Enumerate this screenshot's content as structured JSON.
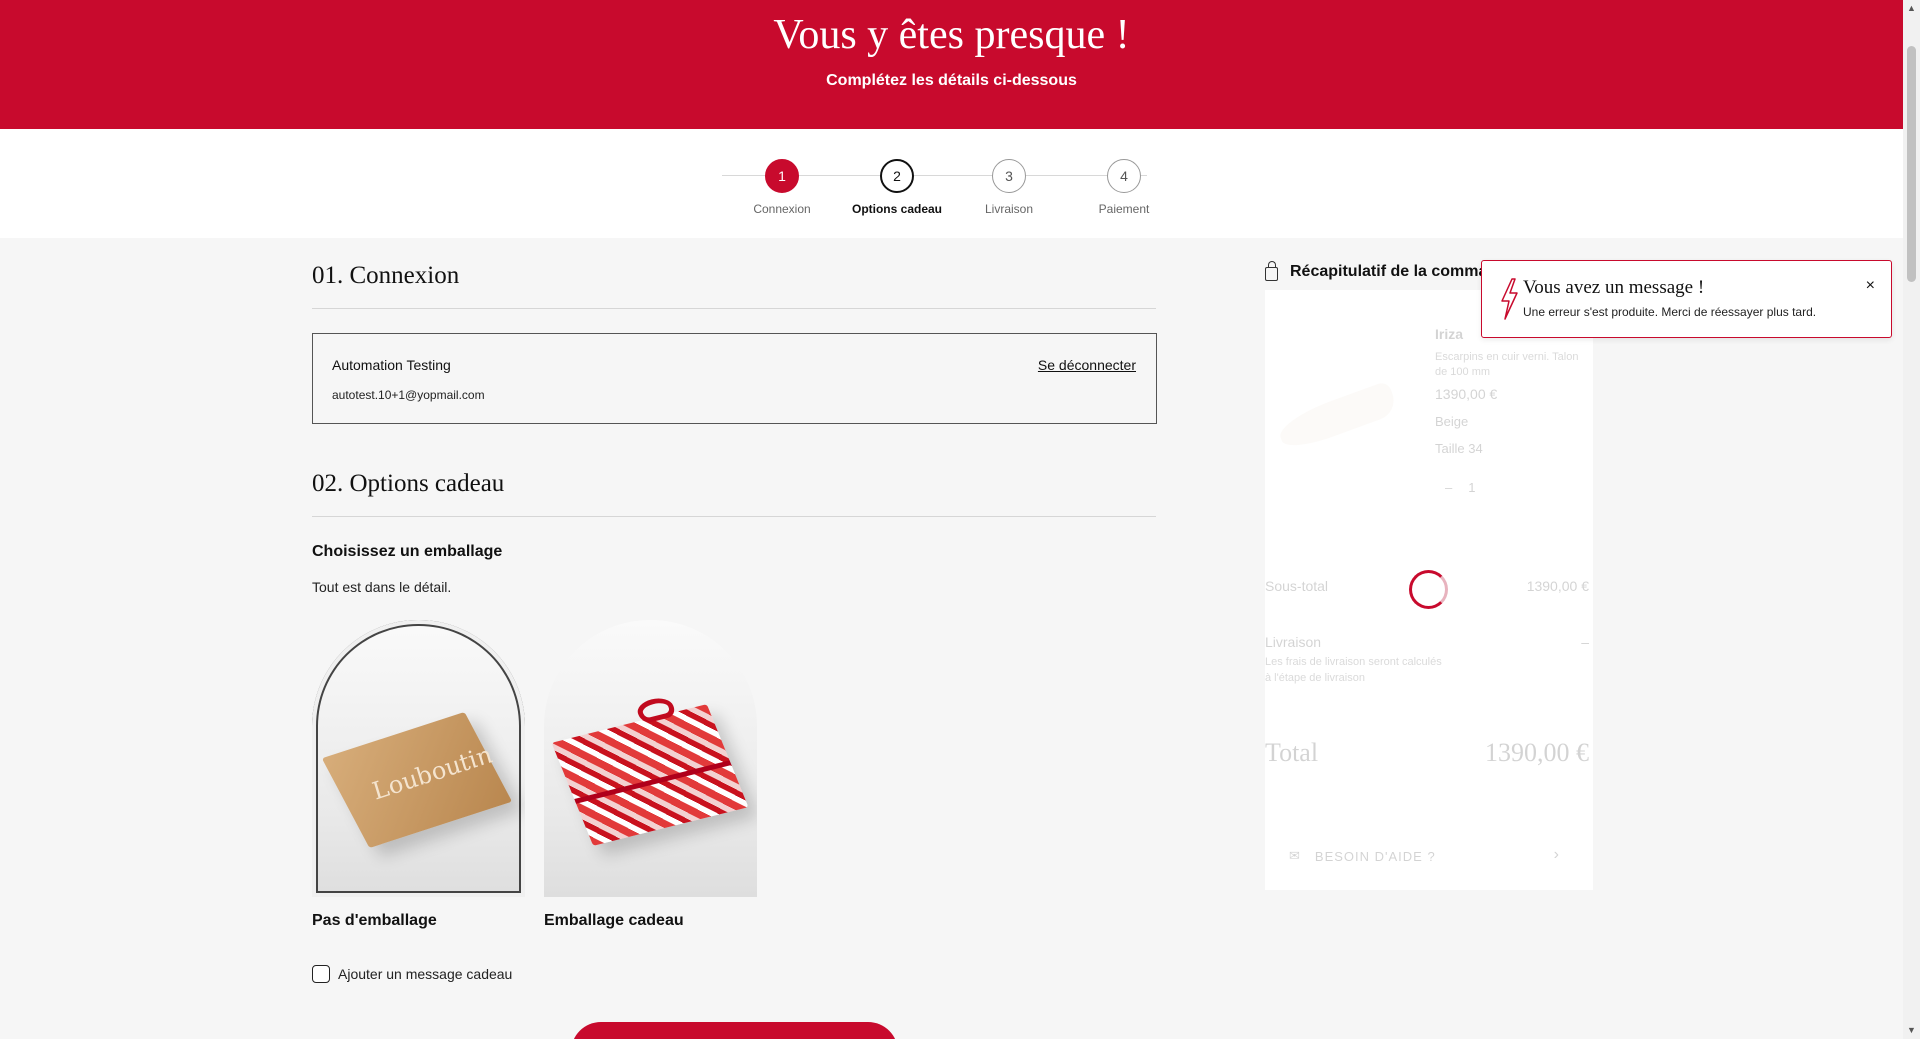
{
  "hero": {
    "title": "Vous y êtes presque !",
    "subtitle": "Complétez les détails ci-dessous"
  },
  "steps": [
    {
      "number": "1",
      "label": "Connexion",
      "state": "done"
    },
    {
      "number": "2",
      "label": "Options cadeau",
      "state": "current"
    },
    {
      "number": "3",
      "label": "Livraison",
      "state": "todo"
    },
    {
      "number": "4",
      "label": "Paiement",
      "state": "todo"
    }
  ],
  "login": {
    "title": "01. Connexion",
    "name": "Automation Testing",
    "email": "autotest.10+1@yopmail.com",
    "logout_label": "Se déconnecter"
  },
  "gift": {
    "title": "02. Options cadeau",
    "wrapping_title": "Choisissez un emballage",
    "wrapping_subtitle": "Tout est dans le détail.",
    "options": [
      {
        "label": "Pas d'emballage",
        "selected": true
      },
      {
        "label": "Emballage cadeau",
        "selected": false
      }
    ],
    "message_checkbox_label": "Ajouter un message cadeau",
    "message_checked": false
  },
  "summary": {
    "title": "Récapitulatif de la comma",
    "product": {
      "name": "Iriza",
      "description": "Escarpins en cuir verni. Talon de 100 mm",
      "price": "1390,00 €",
      "color": "Beige",
      "size": "Taille 34",
      "quantity": "1"
    },
    "subtotal_label": "Sous-total",
    "subtotal_value": "1390,00 €",
    "shipping_label": "Livraison",
    "shipping_value": "–",
    "shipping_note": "Les frais de livraison seront calculés à l'étape de livraison",
    "total_label": "Total",
    "total_value": "1390,00 €",
    "help_label": "BESOIN D'AIDE ?"
  },
  "toast": {
    "title": "Vous avez un message !",
    "text": "Une erreur s'est produite. Merci de réessayer plus tard.",
    "close": "×"
  },
  "colors": {
    "brand_red": "#c80a2d",
    "background": "#f6f6f6"
  },
  "icons": {
    "bag": "shopping-bag-icon",
    "toast": "lightning-icon",
    "close": "close-icon",
    "help": "mail-icon"
  }
}
